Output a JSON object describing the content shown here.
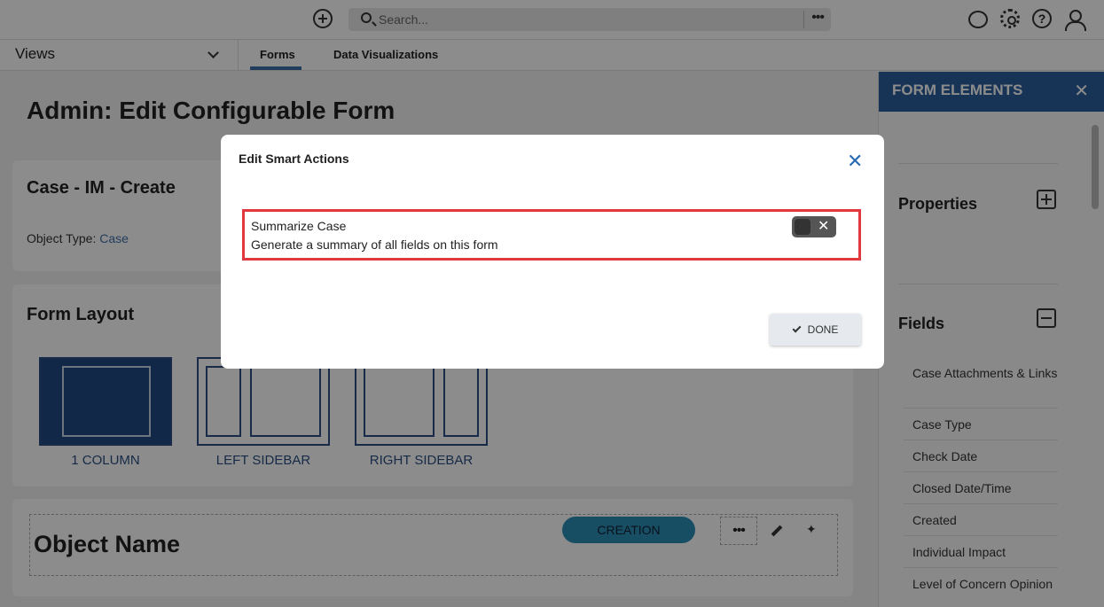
{
  "topbar": {
    "search_placeholder": "Search...",
    "more_glyph": "•••",
    "help_glyph": "?"
  },
  "subnav": {
    "views_label": "Views",
    "tabs": [
      {
        "label": "Forms",
        "active": true
      },
      {
        "label": "Data Visualizations",
        "active": false
      }
    ]
  },
  "main": {
    "page_title": "Admin: Edit Configurable Form",
    "form_card": {
      "title": "Case - IM - Create",
      "object_type_label": "Object Type:",
      "object_type_value": "Case"
    },
    "layout_card": {
      "title": "Form Layout",
      "options": [
        {
          "label": "1 COLUMN",
          "selected": true
        },
        {
          "label": "LEFT SIDEBAR",
          "selected": false
        },
        {
          "label": "RIGHT SIDEBAR",
          "selected": false
        }
      ]
    },
    "object_card": {
      "title": "Object Name",
      "badge": "CREATION",
      "more_glyph": "•••",
      "sparkle_glyph": "✦"
    }
  },
  "right_panel": {
    "title": "FORM ELEMENTS",
    "close_glyph": "✕",
    "properties_label": "Properties",
    "fields_label": "Fields",
    "fields": [
      "Case Attachments & Links",
      "Case Type",
      "Check Date",
      "Closed Date/Time",
      "Created",
      "Individual Impact",
      "Level of Concern Opinion"
    ]
  },
  "modal": {
    "title": "Edit Smart Actions",
    "close_glyph": "✕",
    "action_name": "Summarize Case",
    "action_description": "Generate a summary of all fields on this form",
    "toggle_state": "off",
    "toggle_glyph": "✕",
    "done_label": "DONE"
  },
  "colors": {
    "accent": "#2a5f9e",
    "highlight_border": "#e0383e",
    "badge": "#2a8fb7"
  }
}
